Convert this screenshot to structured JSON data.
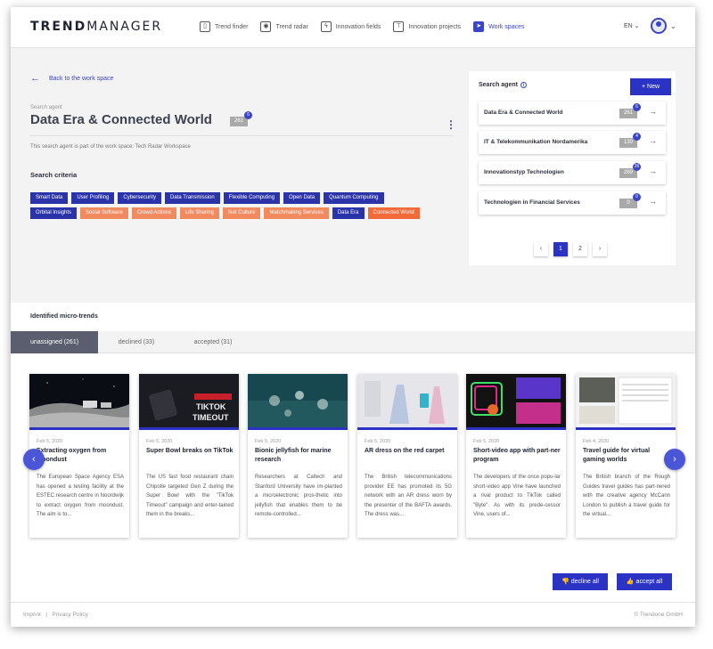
{
  "app": {
    "logo_bold": "TREND",
    "logo_light": "MANAGER"
  },
  "nav": [
    {
      "label": "Trend finder",
      "icon": "trend-finder-icon",
      "glyph": "▯"
    },
    {
      "label": "Trend radar",
      "icon": "radar-icon",
      "glyph": "◉"
    },
    {
      "label": "Innovation fields",
      "icon": "lightning-icon",
      "glyph": "ϟ"
    },
    {
      "label": "Innovation projects",
      "icon": "projects-icon",
      "glyph": "⊤"
    },
    {
      "label": "Work spaces",
      "icon": "send-icon",
      "glyph": "➤"
    }
  ],
  "header": {
    "language": "EN ⌄"
  },
  "agent": {
    "back_label": "Back to the work space",
    "label": "Search agent",
    "title": "Data Era & Connected World",
    "count": "261",
    "badge": "6",
    "part_of": "This search agent is part of the work space: Tech Radar Workspace"
  },
  "criteria": {
    "title": "Search criteria",
    "tags": [
      {
        "label": "Smart Data",
        "color": "blue"
      },
      {
        "label": "User Profiling",
        "color": "blue"
      },
      {
        "label": "Cybersecurity",
        "color": "blue"
      },
      {
        "label": "Data Transmission",
        "color": "blue"
      },
      {
        "label": "Flexible Computing",
        "color": "blue"
      },
      {
        "label": "Open Data",
        "color": "blue"
      },
      {
        "label": "Quantum Computing",
        "color": "blue"
      },
      {
        "label": "Orbital Insights",
        "color": "blue"
      },
      {
        "label": "Social Software",
        "color": "orange"
      },
      {
        "label": "Crowd Actions",
        "color": "orange"
      },
      {
        "label": "Life Sharing",
        "color": "orange"
      },
      {
        "label": "Net Culture",
        "color": "orange"
      },
      {
        "label": "Matchmaking Services",
        "color": "orange"
      },
      {
        "label": "Data Era",
        "color": "blue"
      },
      {
        "label": "Connected World",
        "color": "red"
      }
    ]
  },
  "panel": {
    "title": "Search agent",
    "new_label": "New",
    "agents": [
      {
        "name": "Data Era & Connected World",
        "count": "261",
        "badge": "6"
      },
      {
        "name": "IT & Telekommunikation Nordamerika",
        "count": "130",
        "badge": "4"
      },
      {
        "name": "Innovationstyp Technologien",
        "count": "269",
        "badge": "26"
      },
      {
        "name": "Technologien in Financial Services",
        "count": "0",
        "badge": "0"
      }
    ],
    "pages": [
      "‹",
      "1",
      "2",
      "›"
    ]
  },
  "microtrends": {
    "title": "Identified micro-trends",
    "tabs": [
      "unassigned (261)",
      "declined (33)",
      "accepted (31)"
    ],
    "cards": [
      {
        "date": "Feb 5, 2020",
        "title": "Extracting oxygen from moondust",
        "text": "The European Space Agency ESA has opened a testing facility at the ESTEC research centre in Noordwijk to extract oxygen from moondust. The aim is to..."
      },
      {
        "date": "Feb 5, 2020",
        "title": "Super Bowl breaks on TikTok",
        "text": "The US fast food restaurant chain Chipotle targeted Gen Z during the Super Bowl with the \"TikTok Timeout\" campaign and enter-tained them in the breaks..."
      },
      {
        "date": "Feb 5, 2020",
        "title": "Bionic jellyfish for marine research",
        "text": "Researchers at Caltech and Stanford University have im-planted a microelectronic pros-thetic into jellyfish that enables them to be remote-controlled..."
      },
      {
        "date": "Feb 5, 2020",
        "title": "AR dress on the red carpet",
        "text": "The British telecommunications provider EE has promoted its 5G network with an AR dress worn by the presenter of the BAFTA awards. The dress was..."
      },
      {
        "date": "Feb 5, 2020",
        "title": "Short-video app with part-ner program",
        "text": "The developers of the once popu-lar short-video app Vine have launched a rival product to TikTok called \"Byte\". As with its prede-cessor Vine, users of..."
      },
      {
        "date": "Feb 4, 2020",
        "title": "Travel guide for virtual gaming worlds",
        "text": "The British branch of the Rough Guides travel guides has part-nered with the creative agency McCann London to publish a travel guide for the virtual..."
      }
    ],
    "decline_all": "decline all",
    "accept_all": "accept all"
  },
  "footer": {
    "imprint": "Imprint",
    "privacy": "Privacy Policy",
    "copyright": "© Trendone GmbH"
  },
  "colors": {
    "accent": "#2b33c4",
    "tag_blue": "#2b33a8",
    "tag_orange": "#f28a60",
    "tag_red": "#f26a3a"
  }
}
